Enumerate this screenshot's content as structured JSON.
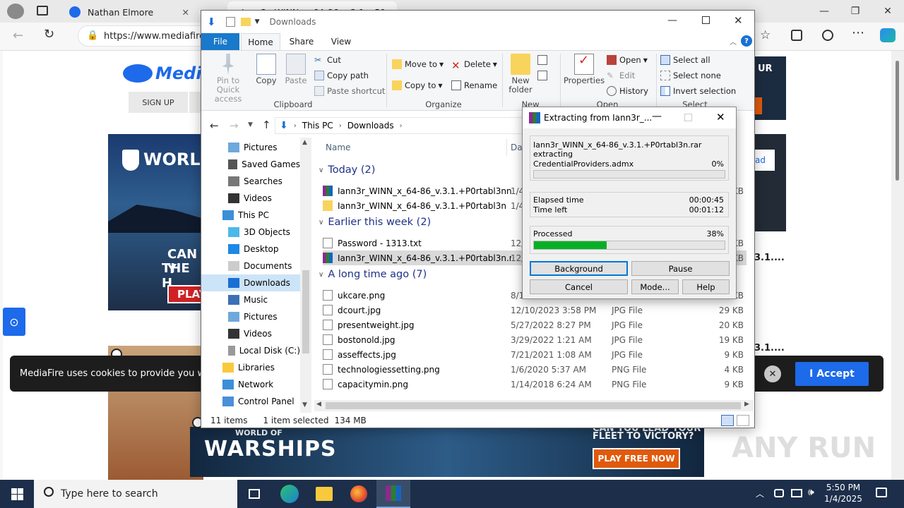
{
  "browser": {
    "tabs": [
      {
        "label": "Nathan Elmore"
      },
      {
        "label": "Iann3r_WINN_x_64-86_v.3.1.+P0..."
      }
    ],
    "url": "https://www.mediafire",
    "controls": {
      "minimize": "—",
      "restore": "❐",
      "close": "✕"
    }
  },
  "mediafire": {
    "logo_text": "Media",
    "signup": "SIGN UP",
    "ad_world": "WORLD",
    "ad_can": "CAN Y",
    "ad_the": "THE H",
    "ad_play": "PLAY",
    "ad_right_top": "UR",
    "ad_right_mid": "ad",
    "file_right_1": "3.1....",
    "file_right_2": "3.1....",
    "cookie_text": "MediaFire uses cookies to provide you with a",
    "accept": "I Accept",
    "bottom_ad": {
      "line1": "WORLD OF",
      "line2": "WARSHIPS",
      "tagline1": "CAN YOU LEAD YOUR",
      "tagline2": "FLEET TO VICTORY?",
      "cta": "PLAY FREE NOW"
    },
    "watermark": "ANY RUN",
    "accent": "#1d6aea"
  },
  "explorer": {
    "title": "Downloads",
    "ribbon_tabs": [
      "File",
      "Home",
      "Share",
      "View"
    ],
    "clipboard": {
      "pin": "Pin to Quick access",
      "copy": "Copy",
      "paste": "Paste",
      "cut": "Cut",
      "copy_path": "Copy path",
      "paste_shortcut": "Paste shortcut",
      "label": "Clipboard"
    },
    "organize": {
      "move_to": "Move to",
      "copy_to": "Copy to",
      "delete": "Delete",
      "rename": "Rename",
      "label": "Organize"
    },
    "new": {
      "new_folder": "New folder",
      "label": "New"
    },
    "open": {
      "properties": "Properties",
      "open": "Open",
      "edit": "Edit",
      "history": "History",
      "label": "Open"
    },
    "select": {
      "select_all": "Select all",
      "select_none": "Select none",
      "invert": "Invert selection",
      "label": "Select"
    },
    "breadcrumb": [
      "This PC",
      "Downloads"
    ],
    "nav_tree": [
      {
        "label": "Pictures",
        "icon": "pictures-icon"
      },
      {
        "label": "Saved Games",
        "icon": "saved-games-icon"
      },
      {
        "label": "Searches",
        "icon": "search-icon"
      },
      {
        "label": "Videos",
        "icon": "videos-icon"
      },
      {
        "label": "This PC",
        "icon": "computer-icon"
      },
      {
        "label": "3D Objects",
        "icon": "3d-objects-icon"
      },
      {
        "label": "Desktop",
        "icon": "desktop-icon"
      },
      {
        "label": "Documents",
        "icon": "documents-icon"
      },
      {
        "label": "Downloads",
        "icon": "downloads-icon"
      },
      {
        "label": "Music",
        "icon": "music-icon"
      },
      {
        "label": "Pictures",
        "icon": "pictures-icon"
      },
      {
        "label": "Videos",
        "icon": "videos-icon"
      },
      {
        "label": "Local Disk (C:)",
        "icon": "disk-icon"
      },
      {
        "label": "Libraries",
        "icon": "libraries-icon"
      },
      {
        "label": "Network",
        "icon": "network-icon"
      },
      {
        "label": "Control Panel",
        "icon": "control-panel-icon"
      }
    ],
    "columns": {
      "name": "Name",
      "date": "Dat"
    },
    "groups": [
      {
        "label": "Today (2)"
      },
      {
        "label": "Earlier this week (2)"
      },
      {
        "label": "A long time ago (7)"
      }
    ],
    "files": [
      {
        "name": "Iann3r_WINN_x_64-86_v.3.1.+P0rtabl3nn....",
        "date": "1/4",
        "type": "",
        "size": "KB",
        "icon": "rar-icon"
      },
      {
        "name": "Iann3r_WINN_x_64-86_v.3.1.+P0rtabl3n",
        "date": "1/4",
        "type": "",
        "size": "",
        "icon": "folder-icon"
      },
      {
        "name": "Password - 1313.txt",
        "date": "12/",
        "type": "",
        "size": "KB",
        "icon": "txt-icon"
      },
      {
        "name": "Iann3r_WINN_x_64-86_v.3.1.+P0rtabl3n.rar",
        "date": "12/",
        "type": "",
        "size": "KB",
        "icon": "rar-icon"
      },
      {
        "name": "ukcare.png",
        "date": "8/1",
        "type": "",
        "size": "KB",
        "icon": "image-icon"
      },
      {
        "name": "dcourt.jpg",
        "date": "12/10/2023 3:58 PM",
        "type": "JPG File",
        "size": "29 KB",
        "icon": "image-icon"
      },
      {
        "name": "presentweight.jpg",
        "date": "5/27/2022 8:27 PM",
        "type": "JPG File",
        "size": "20 KB",
        "icon": "image-icon"
      },
      {
        "name": "bostonold.jpg",
        "date": "3/29/2022 1:21 AM",
        "type": "JPG File",
        "size": "19 KB",
        "icon": "image-icon"
      },
      {
        "name": "asseffects.jpg",
        "date": "7/21/2021 1:08 AM",
        "type": "JPG File",
        "size": "9 KB",
        "icon": "image-icon"
      },
      {
        "name": "technologiessetting.png",
        "date": "1/6/2020 5:37 AM",
        "type": "PNG File",
        "size": "4 KB",
        "icon": "image-icon"
      },
      {
        "name": "capacitymin.png",
        "date": "1/14/2018 6:24 AM",
        "type": "PNG File",
        "size": "9 KB",
        "icon": "image-icon"
      }
    ],
    "status": {
      "items": "11 items",
      "selected": "1 item selected",
      "size": "134 MB"
    }
  },
  "rar": {
    "title": "Extracting from Iann3r_...",
    "archive": "Iann3r_WINN_x_64-86_v.3.1.+P0rtabl3n.rar",
    "action": "extracting",
    "current_file": "CredentialProviders.admx",
    "file_percent": "0%",
    "elapsed_label": "Elapsed time",
    "elapsed": "00:00:45",
    "left_label": "Time left",
    "left": "00:01:12",
    "processed_label": "Processed",
    "processed_percent": "38%",
    "processed_fraction": 0.38,
    "buttons": {
      "background": "Background",
      "pause": "Pause",
      "cancel": "Cancel",
      "mode": "Mode...",
      "help": "Help"
    },
    "bar_color": "#06b025"
  },
  "taskbar": {
    "search_placeholder": "Type here to search",
    "time": "5:50 PM",
    "date": "1/4/2025"
  }
}
